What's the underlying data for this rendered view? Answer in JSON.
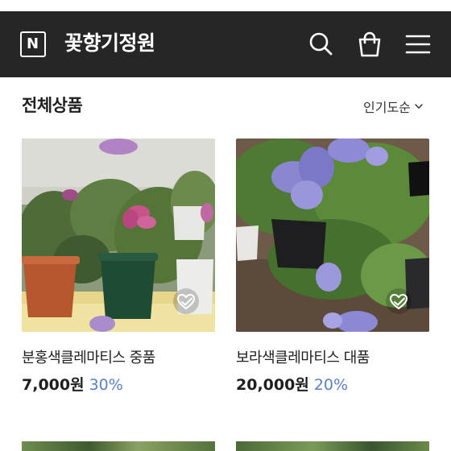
{
  "header": {
    "logo_letter": "N",
    "store_name": "꽃향기정원",
    "icons": [
      "search-icon",
      "shopping-bag-icon",
      "hamburger-menu-icon"
    ],
    "background_color": "#262626"
  },
  "section": {
    "title": "전체상품",
    "sort_label": "인기도순"
  },
  "products": [
    {
      "name": "분홍색클레마티스 중품",
      "price": "7,000원",
      "discount": "30%",
      "wishlist_icon": "heart-icon"
    },
    {
      "name": "보라색클레마티스 대품",
      "price": "20,000원",
      "discount": "20%",
      "wishlist_icon": "heart-icon"
    }
  ],
  "colors": {
    "discount": "#5b7fc4",
    "text": "#1f1f1f"
  }
}
